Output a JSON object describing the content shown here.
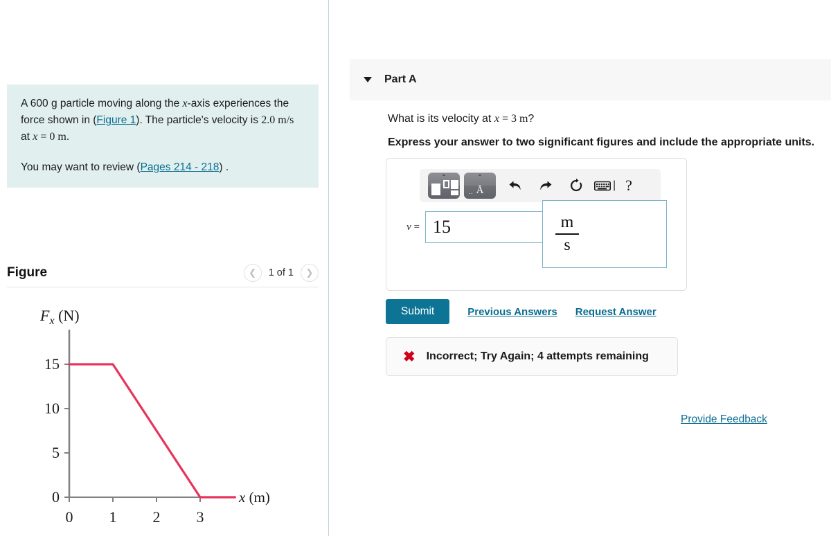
{
  "problem": {
    "line1_a": "A 600 g particle moving along the ",
    "line1_x": "x",
    "line1_b": "-axis experiences the force shown in (",
    "figure_link": "Figure 1",
    "line1_c": "). The particle's velocity is ",
    "line1_v": "2.0 m/s",
    "line1_d": " at ",
    "line1_x2": "x",
    "line1_e": " = 0 m",
    "line1_f": ".",
    "review_prefix": "You may want to review (",
    "review_link": "Pages 214 - 218",
    "review_suffix": ") ."
  },
  "figure": {
    "title": "Figure",
    "count_label": "1 of 1",
    "prev_icon": "chevron-left",
    "next_icon": "chevron-right"
  },
  "chart_data": {
    "type": "line",
    "title": "",
    "xlabel": "x (m)",
    "ylabel": "F_x (N)",
    "x": [
      0,
      1,
      3,
      3.8
    ],
    "values": [
      15,
      15,
      0,
      0
    ],
    "xticks": [
      "0",
      "1",
      "2",
      "3"
    ],
    "xtick_values": [
      0,
      1,
      2,
      3
    ],
    "yticks": [
      "0",
      "5",
      "10",
      "15"
    ],
    "ytick_values": [
      0,
      5,
      10,
      15
    ],
    "xlim": [
      0,
      3.8
    ],
    "ylim": [
      0,
      17
    ],
    "grid": false,
    "legend": "none",
    "line_color": "#e8335c",
    "axis_color": "#808080"
  },
  "part": {
    "caret_icon": "caret-down-icon",
    "title": "Part A",
    "question_a": "What is its velocity at ",
    "question_x": "x",
    "question_b": " = 3 m",
    "question_c": "?",
    "instruction": "Express your answer to two significant figures and include the appropriate units."
  },
  "toolbar": {
    "templates_icon": "math-templates-icon",
    "units_icon": "units-angstrom-icon",
    "undo_icon": "undo-arrow-icon",
    "redo_icon": "redo-arrow-icon",
    "reset_icon": "reset-circular-arrow-icon",
    "keyboard_icon": "keyboard-icon",
    "keyboard_cursor": "|",
    "help_label": "?"
  },
  "answer": {
    "variable": "v",
    "equals": " =",
    "value": "15",
    "value_placeholder": "",
    "unit_numerator": "m",
    "unit_denominator": "s"
  },
  "actions": {
    "submit_label": "Submit",
    "previous_answers_label": "Previous Answers",
    "request_answer_label": "Request Answer"
  },
  "feedback_banner": {
    "icon": "x-mark-icon",
    "icon_glyph": "✖",
    "text": "Incorrect; Try Again; 4 attempts remaining"
  },
  "provide_feedback": {
    "label": "Provide Feedback"
  },
  "colors": {
    "accent_teal": "#0d7496",
    "link_blue": "#0a6d91",
    "problem_bg": "#e1f0ef",
    "error_red": "#d0021b",
    "curve_red": "#e8335c",
    "input_border": "#7fb3c8"
  }
}
